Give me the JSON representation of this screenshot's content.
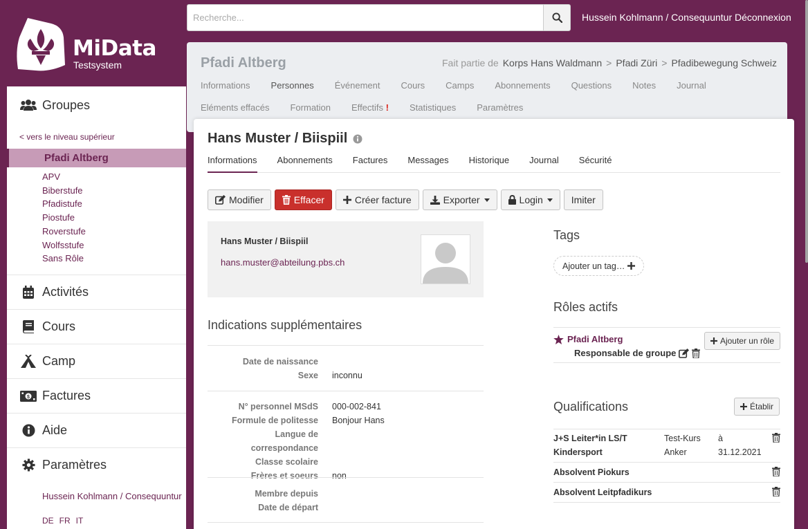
{
  "brand": {
    "name": "MiData",
    "subtitle": "Testsystem"
  },
  "topbar": {
    "search_placeholder": "Recherche...",
    "user": "Hussein Kohlmann / Consequuntur",
    "logout": "Déconnexion"
  },
  "sidebar": {
    "groups_label": "Groupes",
    "up_link": "< vers le niveau supérieur",
    "current_group": "Pfadi Altberg",
    "subgroups": [
      "APV",
      "Biberstufe",
      "Pfadistufe",
      "Piostufe",
      "Roverstufe",
      "Wolfsstufe",
      "Sans Rôle"
    ],
    "sections": [
      {
        "label": "Activités",
        "icon": "calendar-icon"
      },
      {
        "label": "Cours",
        "icon": "book-icon"
      },
      {
        "label": "Camp",
        "icon": "tent-icon"
      },
      {
        "label": "Factures",
        "icon": "money-bill-icon"
      },
      {
        "label": "Aide",
        "icon": "info-circle-icon"
      },
      {
        "label": "Paramètres",
        "icon": "cog-icon"
      }
    ],
    "user": "Hussein Kohlmann / Consequuntur",
    "languages": [
      "DE",
      "FR",
      "IT"
    ]
  },
  "group": {
    "title": "Pfadi Altberg",
    "breadcrumb_label": "Fait partie de",
    "breadcrumb": [
      "Korps Hans Waldmann",
      "Pfadi Züri",
      "Pfadibewegung Schweiz"
    ],
    "breadcrumb_sep": ">",
    "tabs_row1": [
      "Informations",
      "Personnes",
      "Événement",
      "Cours",
      "Camps",
      "Abonnements",
      "Questions",
      "Notes",
      "Journal"
    ],
    "tabs_row2": [
      "Eléments effacés",
      "Formation",
      "Effectifs",
      "Statistiques",
      "Paramètres"
    ],
    "effectifs_alert": "!"
  },
  "person": {
    "title": "Hans Muster / Biispiil",
    "tabs": [
      "Informations",
      "Abonnements",
      "Factures",
      "Messages",
      "Historique",
      "Journal",
      "Sécurité"
    ],
    "actions": {
      "edit": "Modifier",
      "delete": "Effacer",
      "invoice": "Créer facture",
      "export": "Exporter",
      "login": "Login",
      "impersonate": "Imiter"
    },
    "contact": {
      "name": "Hans Muster / Biispiil",
      "email": "hans.muster@abteilung.pbs.ch"
    },
    "additional_title": "Indications supplémentaires",
    "fields": {
      "birthday": {
        "label": "Date de naissance",
        "value": ""
      },
      "gender": {
        "label": "Sexe",
        "value": "inconnu"
      },
      "msds": {
        "label": "N° personnel MSdS",
        "value": "000-002-841"
      },
      "salutation": {
        "label": "Formule de politesse",
        "value": "Bonjour Hans"
      },
      "language": {
        "label": "Langue de correspondance",
        "value": ""
      },
      "school_class": {
        "label": "Classe scolaire",
        "value": ""
      },
      "siblings": {
        "label": "Frères et soeurs",
        "value": "non"
      },
      "member_since": {
        "label": "Membre depuis",
        "value": ""
      },
      "leave_date": {
        "label": "Date de départ",
        "value": ""
      }
    },
    "tags_title": "Tags",
    "add_tag": "Ajouter un tag…",
    "roles_title": "Rôles actifs",
    "role_group": "Pfadi Altberg",
    "role_type": "Responsable de groupe",
    "add_role": "Ajouter un rôle",
    "qualifications_title": "Qualifications",
    "establish": "Établir",
    "qualifications": [
      {
        "name_line1": "J+S Leiter*in LS/T",
        "name_line2": "Kindersport",
        "source_line1": "Test-Kurs",
        "source_line2": "Anker",
        "date_line1": "à",
        "date_line2": "31.12.2021"
      },
      {
        "name_line1": "Absolvent Piokurs",
        "name_line2": "",
        "source_line1": "",
        "source_line2": "",
        "date_line1": "",
        "date_line2": ""
      },
      {
        "name_line1": "Absolvent Leitpfadikurs",
        "name_line2": "",
        "source_line1": "",
        "source_line2": "",
        "date_line1": "",
        "date_line2": ""
      }
    ]
  },
  "colors": {
    "brand": "#6b2452",
    "danger": "#c9302c",
    "sidebar_active": "#c79bb7"
  }
}
